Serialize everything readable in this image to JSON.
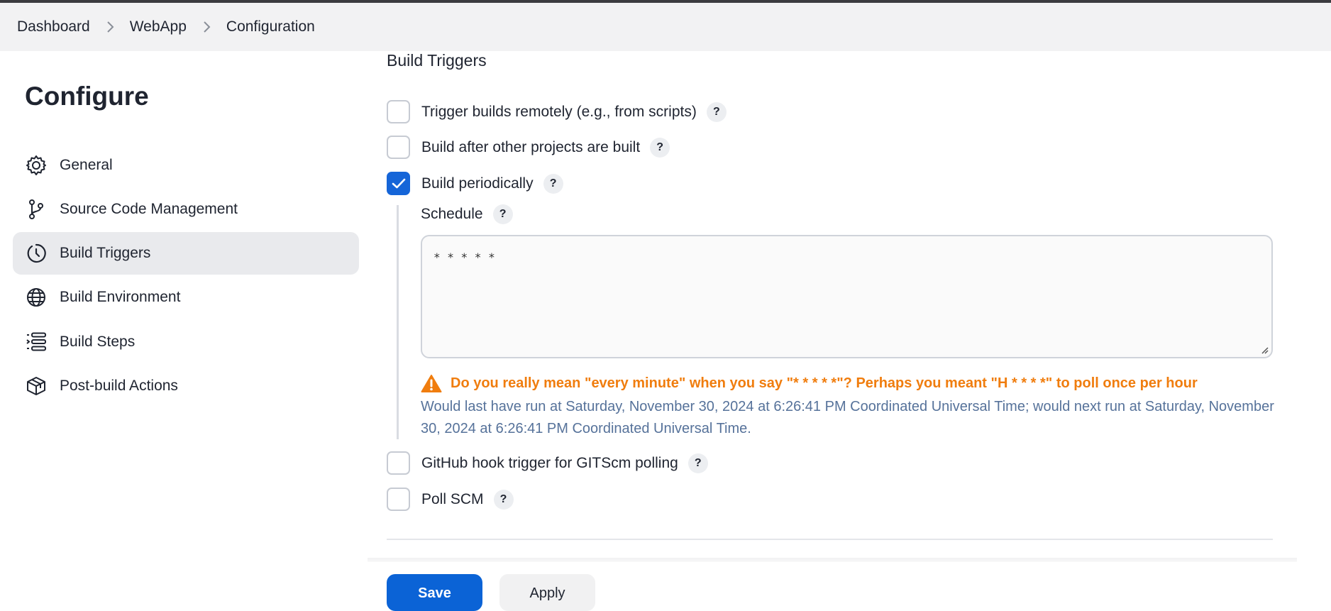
{
  "breadcrumb": {
    "items": [
      "Dashboard",
      "WebApp",
      "Configuration"
    ]
  },
  "sidebar": {
    "title": "Configure",
    "items": [
      {
        "label": "General",
        "icon": "gear-icon",
        "active": false
      },
      {
        "label": "Source Code Management",
        "icon": "branch-icon",
        "active": false
      },
      {
        "label": "Build Triggers",
        "icon": "clock-icon",
        "active": true
      },
      {
        "label": "Build Environment",
        "icon": "globe-icon",
        "active": false
      },
      {
        "label": "Build Steps",
        "icon": "list-icon",
        "active": false
      },
      {
        "label": "Post-build Actions",
        "icon": "package-icon",
        "active": false
      }
    ]
  },
  "main": {
    "section_title": "Build Triggers",
    "triggers": [
      {
        "label": "Trigger builds remotely (e.g., from scripts)",
        "checked": false
      },
      {
        "label": "Build after other projects are built",
        "checked": false
      },
      {
        "label": "Build periodically",
        "checked": true
      },
      {
        "label": "GitHub hook trigger for GITScm polling",
        "checked": false
      },
      {
        "label": "Poll SCM",
        "checked": false
      }
    ],
    "help_label": "?",
    "schedule": {
      "label": "Schedule",
      "value": "* * * * *",
      "warning": "Do you really mean \"every minute\" when you say \"* * * * *\"? Perhaps you meant \"H * * * *\" to poll once per hour",
      "info": "Would last have run at Saturday, November 30, 2024 at 6:26:41 PM Coordinated Universal Time; would next run at Saturday, November 30, 2024 at 6:26:41 PM Coordinated Universal Time."
    }
  },
  "buttons": {
    "save": "Save",
    "apply": "Apply"
  },
  "colors": {
    "accent": "#1565d8",
    "warning": "#f07d0e",
    "info": "#56729a",
    "active_bg": "#e9eaed"
  }
}
